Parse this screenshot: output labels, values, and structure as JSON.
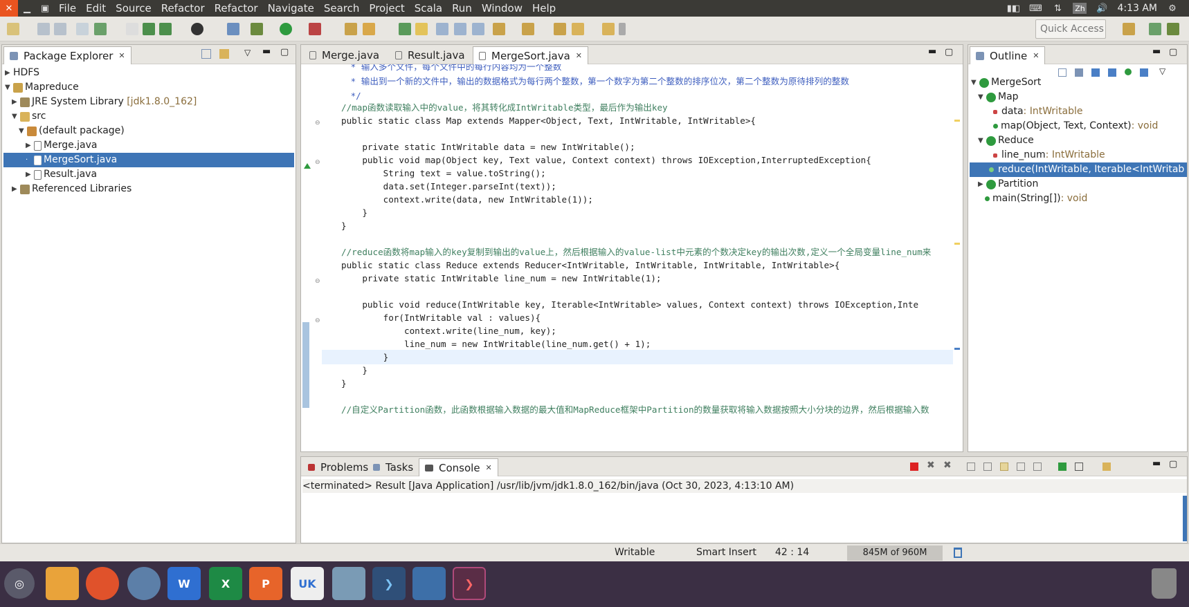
{
  "menubar": {
    "items": [
      "File",
      "Edit",
      "Source",
      "Refactor",
      "Refactor",
      "Navigate",
      "Search",
      "Project",
      "Scala",
      "Run",
      "Window",
      "Help"
    ],
    "tray": {
      "lang": "Zh",
      "clock": "4:13 AM"
    }
  },
  "toolbar": {
    "quick_access": "Quick Access"
  },
  "package_explorer": {
    "title": "Package Explorer",
    "tree": [
      {
        "label": "HDFS"
      },
      {
        "label": "Mapreduce"
      },
      {
        "label": "JRE System Library",
        "extra": "[jdk1.8.0_162]"
      },
      {
        "label": "src"
      },
      {
        "label": "(default package)"
      },
      {
        "label": "Merge.java"
      },
      {
        "label": "MergeSort.java"
      },
      {
        "label": "Result.java"
      },
      {
        "label": "Referenced Libraries"
      }
    ]
  },
  "editor": {
    "tabs": [
      "Merge.java",
      "Result.java",
      "MergeSort.java"
    ],
    "lines": [
      " * 输入多个文件，每个文件中的每行内容均为一个整数",
      " * 输出到一个新的文件中，输出的数据格式为每行两个整数，第一个数字为第二个整数的排序位次，第二个整数为原待排列的整数",
      " */",
      "//map函数读取输入中的value，将其转化成IntWritable类型，最后作为输出key",
      "public static class Map extends Mapper<Object, Text, IntWritable, IntWritable>{",
      "",
      "    private static IntWritable data = new IntWritable();",
      "    public void map(Object key, Text value, Context context) throws IOException,InterruptedException{",
      "        String text = value.toString();",
      "        data.set(Integer.parseInt(text));",
      "        context.write(data, new IntWritable(1));",
      "    }",
      "}",
      "",
      "//reduce函数将map输入的key复制到输出的value上，然后根据输入的value-list中元素的个数决定key的输出次数,定义一个全局变量line_num来",
      "public static class Reduce extends Reducer<IntWritable, IntWritable, IntWritable, IntWritable>{",
      "    private static IntWritable line_num = new IntWritable(1);",
      "",
      "    public void reduce(IntWritable key, Iterable<IntWritable> values, Context context) throws IOException,Inte",
      "        for(IntWritable val : values){",
      "            context.write(line_num, key);",
      "            line_num = new IntWritable(line_num.get() + 1);",
      "        }",
      "    }",
      "}",
      "",
      "//自定义Partition函数，此函数根据输入数据的最大值和MapReduce框架中Partition的数量获取将输入数据按照大小分块的边界，然后根据输入数"
    ]
  },
  "outline": {
    "title": "Outline",
    "tree": [
      {
        "label": "MergeSort"
      },
      {
        "label": "Map"
      },
      {
        "label": "data",
        "type": " : IntWritable"
      },
      {
        "label": "map(Object, Text, Context)",
        "type": " : void"
      },
      {
        "label": "Reduce"
      },
      {
        "label": "line_num",
        "type": " : IntWritable"
      },
      {
        "label": "reduce(IntWritable, Iterable<IntWritab"
      },
      {
        "label": "Partition"
      },
      {
        "label": "main(String[])",
        "type": " : void"
      }
    ]
  },
  "console": {
    "tabs": [
      "Problems",
      "Tasks",
      "Console"
    ],
    "text": "<terminated> Result [Java Application] /usr/lib/jvm/jdk1.8.0_162/bin/java (Oct 30, 2023, 4:13:10 AM)"
  },
  "status": {
    "writable": "Writable",
    "insert": "Smart Insert",
    "position": "42 : 14",
    "memory": "845M of 960M"
  },
  "dock": {
    "excel_label": "X",
    "ppt_label": "P",
    "word_label": "W",
    "uk_label": "UK"
  },
  "colors": {
    "accent": "#e95420",
    "selection": "#3e75b6"
  }
}
